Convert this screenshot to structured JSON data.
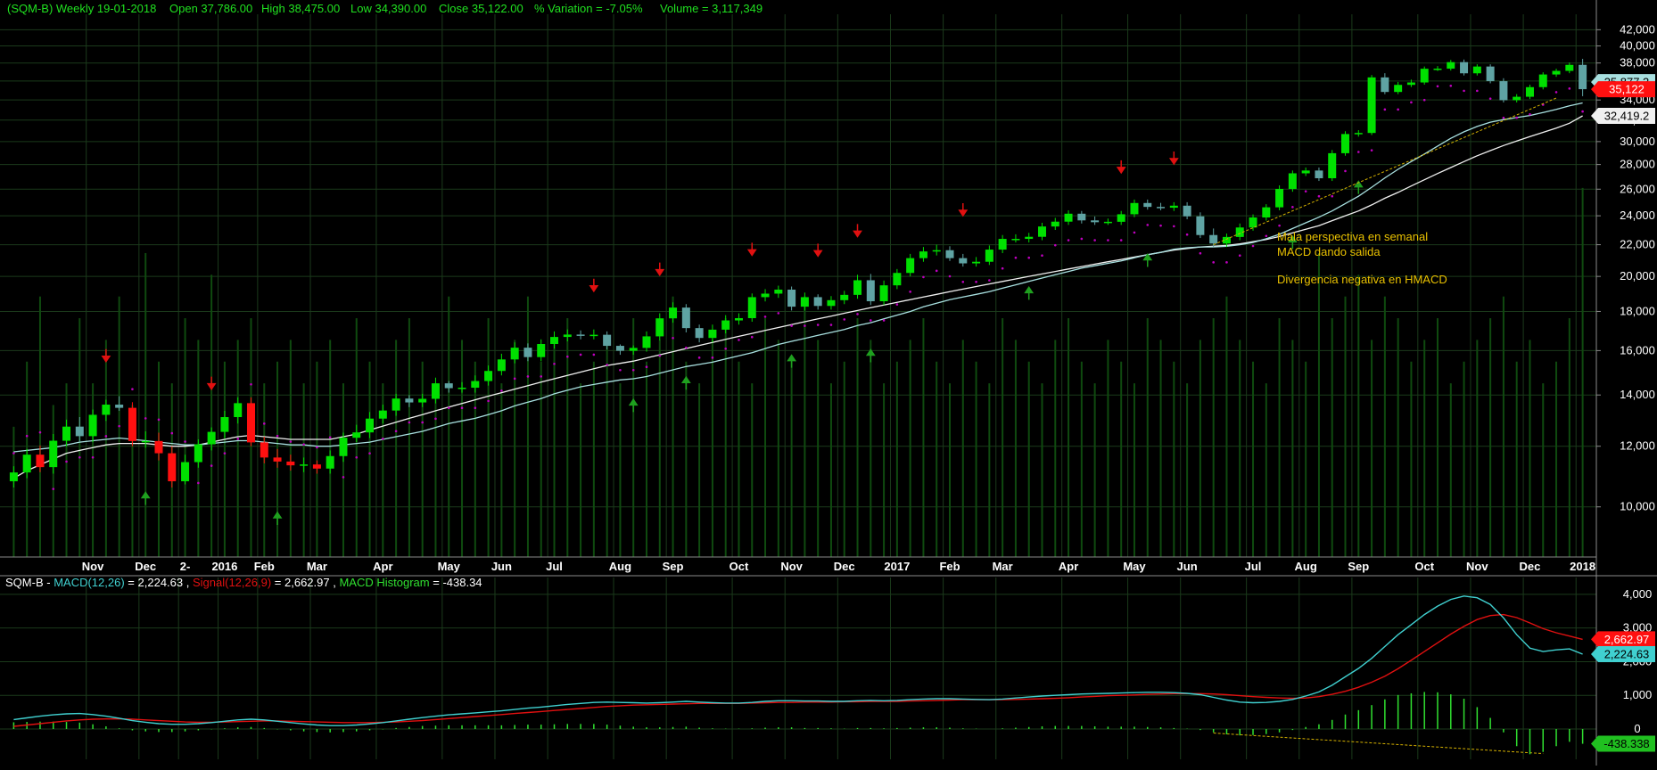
{
  "colors": {
    "background": "#000000",
    "grid": "#1b3a1b",
    "axis": "#8a8a8a",
    "up_candle": "#00e000",
    "down_candle": "#ff1010",
    "neutral_candle": "#5fa3a3",
    "ma_short": "#a8e0e0",
    "ma_long": "#f0f0f0",
    "sar_dots": "#c000c0",
    "volume": "#0f4a0f",
    "trendline": "#d4b000",
    "annotation": "#e8c000",
    "macd": "#40d0d0",
    "signal": "#e01010",
    "histogram": "#30e030",
    "header_text": "#20e020",
    "arrow_up": "#1fa01f",
    "arrow_down": "#e01010"
  },
  "header": {
    "title": "(SQM-B) Weekly  19-01-2018",
    "open": "Open 37,786.00",
    "high": "High 38,475.00",
    "low": "Low 34,390.00",
    "close": "Close 35,122.00",
    "variation": "% Variation = -7.05%",
    "volume": "Volume = 3,117,349"
  },
  "macd_header": {
    "symbol": "SQM-B",
    "macd_label": "MACD(12,26)",
    "macd_value": "2,224.63",
    "signal_label": "Signal(12,26,9)",
    "signal_value": "2,662.97",
    "hist_label": "MACD Histogram",
    "hist_value": "-438.34"
  },
  "price_axis": {
    "ticks": [
      "42,000",
      "40,000",
      "38,000",
      "36,000",
      "34,000",
      "32,000",
      "30,000",
      "28,000",
      "26,000",
      "24,000",
      "22,000",
      "20,000",
      "18,000",
      "16,000",
      "14,000",
      "12,000",
      "10,000"
    ],
    "tick_values": [
      42000,
      40000,
      38000,
      36000,
      34000,
      32000,
      30000,
      28000,
      26000,
      24000,
      22000,
      20000,
      18000,
      16000,
      14000,
      12000,
      10000
    ],
    "scale": "log",
    "ylim": [
      8600,
      44000
    ]
  },
  "price_tags": [
    {
      "label": "35,877.3",
      "value": 35877.3,
      "bg": "#a8e0e0"
    },
    {
      "label": "35,122",
      "value": 35122,
      "bg": "#ff1010"
    },
    {
      "label": "32,419.2",
      "value": 32419.2,
      "bg": "#f0f0f0"
    }
  ],
  "macd_axis": {
    "ticks": [
      "4,000",
      "3,000",
      "2,000",
      "1,000",
      "0"
    ],
    "tick_values": [
      4000,
      3000,
      2000,
      1000,
      0
    ],
    "ylim": [
      -900,
      4500
    ]
  },
  "macd_tags": [
    {
      "label": "2,662.97",
      "value": 2662.97,
      "bg": "#ff1010"
    },
    {
      "label": "2,224.63",
      "value": 2224.63,
      "bg": "#40d0d0"
    },
    {
      "label": "-438.338",
      "value": -438.338,
      "bg": "#20c020"
    }
  ],
  "x_labels": [
    "Nov",
    "Dec",
    "2-",
    "2016",
    "Feb",
    "Mar",
    "Apr",
    "May",
    "Jun",
    "Jul",
    "Aug",
    "Sep",
    "Oct",
    "Nov",
    "Dec",
    "2017",
    "Feb",
    "Mar",
    "Apr",
    "May",
    "Jun",
    "Jul",
    "Aug",
    "Sep",
    "Oct",
    "Nov",
    "Dec",
    "2018"
  ],
  "x_label_bars": [
    6,
    10,
    13,
    16,
    19,
    23,
    28,
    33,
    37,
    41,
    46,
    50,
    55,
    59,
    63,
    67,
    71,
    75,
    80,
    85,
    89,
    94,
    98,
    102,
    107,
    111,
    115,
    119
  ],
  "annotations": [
    "Mala perspectiva en semanal",
    "MACD dando salida",
    "Divergencia negativa en HMACD"
  ],
  "chart_data": {
    "type": "candlestick",
    "x": "weekly bars, Oct 2015 – 19-01-2018 (120 bars)",
    "candles": {
      "open": [
        10800,
        11090,
        11700,
        11270,
        12200,
        12730,
        12370,
        13190,
        13600,
        13470,
        12190,
        12190,
        11750,
        10800,
        11440,
        12070,
        12530,
        13100,
        13660,
        12140,
        11600,
        11460,
        11330,
        11360,
        11220,
        11650,
        12310,
        12510,
        13040,
        13360,
        13850,
        13690,
        13840,
        14500,
        14290,
        14310,
        14600,
        15050,
        15580,
        16140,
        15690,
        16320,
        16670,
        16790,
        16750,
        16780,
        16230,
        15990,
        16130,
        16700,
        17630,
        18210,
        17120,
        16620,
        17040,
        17520,
        17640,
        18790,
        18990,
        19220,
        18260,
        18790,
        18300,
        18620,
        18920,
        19770,
        18560,
        19470,
        20210,
        21130,
        21560,
        21640,
        21130,
        20800,
        20900,
        21680,
        22390,
        22390,
        22530,
        23240,
        23580,
        24150,
        23670,
        23540,
        23570,
        24110,
        24940,
        24650,
        24590,
        24740,
        23960,
        22650,
        22080,
        22520,
        23170,
        23880,
        24620,
        26020,
        27270,
        27500,
        26870,
        28970,
        30690,
        30790,
        36390,
        34830,
        35580,
        35840,
        37350,
        37360,
        38100,
        36840,
        37600,
        35980,
        33980,
        34330,
        35340,
        36710,
        37110,
        37790
      ],
      "close": [
        11090,
        11700,
        11270,
        12200,
        12730,
        12370,
        13190,
        13600,
        13470,
        12190,
        12190,
        11750,
        10800,
        11440,
        12070,
        12530,
        13100,
        13660,
        12140,
        11600,
        11460,
        11330,
        11360,
        11220,
        11650,
        12310,
        12510,
        13040,
        13360,
        13850,
        13690,
        13840,
        14500,
        14290,
        14310,
        14600,
        15050,
        15580,
        16140,
        15690,
        16320,
        16670,
        16790,
        16750,
        16780,
        16230,
        15990,
        16130,
        16700,
        17630,
        18210,
        17120,
        16620,
        17040,
        17520,
        17640,
        18790,
        18990,
        19220,
        18260,
        18790,
        18300,
        18620,
        18920,
        19770,
        18560,
        19470,
        20210,
        21130,
        21560,
        21640,
        21130,
        20800,
        20900,
        21680,
        22390,
        22390,
        22530,
        23240,
        23580,
        24150,
        23670,
        23540,
        23570,
        24110,
        24940,
        24650,
        24590,
        24740,
        23960,
        22650,
        22080,
        22520,
        23170,
        23880,
        24620,
        26020,
        27270,
        27500,
        26870,
        28970,
        30690,
        30790,
        36390,
        34830,
        35580,
        35840,
        37350,
        37360,
        38100,
        36840,
        37600,
        35980,
        33980,
        34330,
        35340,
        36710,
        37110,
        37790,
        35122
      ],
      "high": [
        11300,
        11900,
        12030,
        12450,
        13000,
        13100,
        13400,
        13800,
        13950,
        13700,
        12550,
        12500,
        12000,
        11700,
        12250,
        12700,
        13350,
        13900,
        13900,
        12350,
        11900,
        11700,
        11600,
        11500,
        11850,
        12500,
        12800,
        13300,
        13600,
        14050,
        14000,
        14050,
        14750,
        14600,
        14550,
        14850,
        15300,
        15850,
        16400,
        16350,
        16550,
        16950,
        17050,
        17000,
        17050,
        16950,
        16300,
        16250,
        16950,
        17900,
        18500,
        18400,
        17300,
        17300,
        17800,
        17900,
        19000,
        19250,
        19450,
        19400,
        19050,
        18950,
        18850,
        19150,
        20100,
        20150,
        19750,
        20450,
        21400,
        21850,
        22000,
        21900,
        21400,
        21200,
        21950,
        22650,
        22700,
        22800,
        23500,
        23850,
        24400,
        24350,
        23950,
        23800,
        24350,
        25200,
        25200,
        24950,
        25000,
        25000,
        24250,
        23100,
        22750,
        23450,
        24100,
        24850,
        26300,
        27500,
        27750,
        27750,
        29250,
        30950,
        31050,
        36650,
        36850,
        35900,
        36150,
        37600,
        37650,
        38350,
        38400,
        37850,
        37850,
        36300,
        34600,
        35600,
        36950,
        37350,
        38050,
        38475
      ],
      "low": [
        10600,
        10900,
        11100,
        11050,
        12000,
        12150,
        12150,
        12950,
        13350,
        12000,
        11950,
        11500,
        10600,
        10700,
        11250,
        11850,
        12300,
        12850,
        12000,
        11400,
        11250,
        11150,
        11100,
        11050,
        11050,
        11450,
        12150,
        12300,
        12850,
        13150,
        13500,
        13500,
        13650,
        14100,
        14100,
        14100,
        14400,
        14850,
        15400,
        15500,
        15500,
        16100,
        16450,
        16550,
        16550,
        16050,
        15800,
        15800,
        15950,
        16500,
        17400,
        16900,
        16400,
        16400,
        16850,
        17300,
        17450,
        18550,
        18750,
        18050,
        18050,
        18100,
        18100,
        18400,
        18700,
        18350,
        18350,
        19250,
        20000,
        20900,
        21300,
        20950,
        20600,
        20600,
        20700,
        21450,
        22150,
        22150,
        22300,
        23000,
        23350,
        23450,
        23350,
        23350,
        23350,
        23900,
        24450,
        24400,
        24350,
        23750,
        22450,
        21850,
        21850,
        22300,
        22950,
        23650,
        24400,
        25800,
        27050,
        26650,
        26650,
        28750,
        30450,
        30600,
        34600,
        34600,
        35350,
        35600,
        37100,
        37150,
        36600,
        36600,
        35750,
        33750,
        33750,
        34100,
        35100,
        36450,
        36850,
        34390
      ]
    },
    "ma_short": [
      11800,
      11850,
      11900,
      11950,
      12050,
      12150,
      12200,
      12250,
      12300,
      12250,
      12200,
      12150,
      12100,
      12050,
      12050,
      12100,
      12150,
      12200,
      12200,
      12150,
      12100,
      12050,
      12050,
      12000,
      12000,
      12050,
      12100,
      12150,
      12250,
      12350,
      12450,
      12550,
      12700,
      12850,
      12950,
      13050,
      13200,
      13350,
      13550,
      13700,
      13850,
      14050,
      14200,
      14350,
      14450,
      14550,
      14650,
      14700,
      14800,
      14950,
      15100,
      15250,
      15350,
      15450,
      15600,
      15750,
      15900,
      16100,
      16300,
      16450,
      16600,
      16750,
      16900,
      17050,
      17250,
      17400,
      17600,
      17800,
      18000,
      18250,
      18450,
      18650,
      18800,
      18950,
      19100,
      19300,
      19500,
      19700,
      19900,
      20100,
      20300,
      20500,
      20650,
      20800,
      20950,
      21150,
      21350,
      21500,
      21700,
      21800,
      21850,
      21850,
      21900,
      22000,
      22150,
      22400,
      22700,
      23100,
      23500,
      23900,
      24350,
      24900,
      25450,
      26150,
      26900,
      27600,
      28250,
      28900,
      29600,
      30300,
      30900,
      31400,
      31800,
      32050,
      32250,
      32450,
      32750,
      33050,
      33400,
      33700
    ],
    "ma_long": [
      10900,
      11150,
      11350,
      11550,
      11750,
      11850,
      11950,
      12050,
      12100,
      12100,
      12100,
      12050,
      12000,
      12000,
      12050,
      12150,
      12250,
      12350,
      12400,
      12350,
      12300,
      12250,
      12250,
      12250,
      12250,
      12350,
      12450,
      12600,
      12750,
      12900,
      13050,
      13200,
      13350,
      13500,
      13650,
      13800,
      13950,
      14100,
      14250,
      14400,
      14550,
      14700,
      14850,
      15000,
      15150,
      15300,
      15400,
      15500,
      15650,
      15800,
      15950,
      16100,
      16250,
      16400,
      16550,
      16700,
      16850,
      17000,
      17150,
      17300,
      17450,
      17600,
      17750,
      17900,
      18050,
      18200,
      18350,
      18500,
      18650,
      18800,
      18950,
      19100,
      19250,
      19400,
      19550,
      19700,
      19850,
      20000,
      20150,
      20300,
      20450,
      20600,
      20750,
      20900,
      21050,
      21200,
      21350,
      21500,
      21650,
      21750,
      21850,
      21900,
      21950,
      22050,
      22200,
      22350,
      22550,
      22800,
      23050,
      23300,
      23650,
      24000,
      24350,
      24800,
      25300,
      25750,
      26250,
      26750,
      27250,
      27750,
      28250,
      28750,
      29200,
      29650,
      30050,
      30450,
      30850,
      31250,
      31700,
      32419
    ],
    "macd": [
      280,
      330,
      380,
      420,
      450,
      460,
      430,
      380,
      320,
      250,
      200,
      160,
      140,
      140,
      160,
      190,
      230,
      270,
      290,
      270,
      230,
      190,
      150,
      120,
      100,
      100,
      120,
      150,
      190,
      240,
      290,
      340,
      380,
      420,
      450,
      480,
      510,
      540,
      580,
      620,
      650,
      690,
      730,
      760,
      790,
      800,
      790,
      780,
      770,
      780,
      800,
      820,
      800,
      780,
      770,
      770,
      790,
      820,
      840,
      840,
      830,
      830,
      820,
      820,
      840,
      850,
      840,
      850,
      870,
      890,
      900,
      900,
      890,
      880,
      870,
      890,
      920,
      950,
      980,
      1000,
      1020,
      1040,
      1050,
      1060,
      1070,
      1080,
      1090,
      1090,
      1080,
      1060,
      1020,
      940,
      860,
      800,
      780,
      790,
      820,
      880,
      980,
      1100,
      1300,
      1550,
      1800,
      2100,
      2450,
      2800,
      3100,
      3400,
      3650,
      3850,
      3950,
      3900,
      3700,
      3300,
      2800,
      2400,
      2300,
      2350,
      2380,
      2224.63
    ],
    "signal": [
      80,
      120,
      160,
      200,
      240,
      270,
      290,
      300,
      300,
      290,
      270,
      250,
      230,
      210,
      200,
      200,
      210,
      220,
      230,
      240,
      240,
      230,
      220,
      210,
      200,
      190,
      190,
      190,
      200,
      210,
      230,
      250,
      280,
      310,
      340,
      370,
      400,
      430,
      460,
      490,
      520,
      550,
      580,
      610,
      640,
      670,
      690,
      710,
      720,
      730,
      740,
      750,
      760,
      760,
      760,
      760,
      770,
      780,
      790,
      790,
      800,
      800,
      800,
      810,
      810,
      820,
      820,
      820,
      830,
      840,
      850,
      860,
      870,
      870,
      870,
      870,
      880,
      890,
      900,
      910,
      930,
      950,
      970,
      990,
      1000,
      1010,
      1030,
      1040,
      1050,
      1050,
      1050,
      1040,
      1020,
      990,
      960,
      940,
      920,
      910,
      920,
      960,
      1030,
      1120,
      1240,
      1390,
      1570,
      1790,
      2040,
      2300,
      2560,
      2820,
      3050,
      3250,
      3370,
      3400,
      3310,
      3150,
      2980,
      2860,
      2760,
      2662.97
    ],
    "histogram": [
      200,
      210,
      220,
      220,
      210,
      190,
      140,
      80,
      20,
      -40,
      -70,
      -90,
      -90,
      -70,
      -40,
      -10,
      20,
      50,
      60,
      30,
      -10,
      -40,
      -70,
      -90,
      -100,
      -90,
      -70,
      -40,
      -10,
      30,
      60,
      90,
      100,
      110,
      110,
      110,
      110,
      110,
      120,
      130,
      130,
      140,
      150,
      150,
      150,
      130,
      100,
      70,
      50,
      50,
      60,
      70,
      40,
      20,
      10,
      10,
      20,
      40,
      50,
      50,
      30,
      30,
      20,
      10,
      30,
      30,
      20,
      30,
      40,
      50,
      50,
      40,
      20,
      10,
      0,
      20,
      40,
      60,
      80,
      90,
      90,
      90,
      80,
      70,
      70,
      70,
      60,
      50,
      30,
      10,
      -30,
      -100,
      -160,
      -190,
      -180,
      -150,
      -100,
      -30,
      60,
      140,
      270,
      430,
      560,
      710,
      880,
      1010,
      1060,
      1100,
      1090,
      1030,
      900,
      650,
      330,
      -100,
      -510,
      -750,
      -680,
      -510,
      -380,
      -438.34
    ],
    "volume": [
      30,
      45,
      60,
      35,
      40,
      55,
      40,
      50,
      60,
      35,
      70,
      45,
      40,
      55,
      50,
      65,
      45,
      50,
      55,
      40,
      45,
      50,
      40,
      45,
      50,
      40,
      55,
      45,
      40,
      50,
      55,
      45,
      40,
      60,
      50,
      45,
      55,
      40,
      50,
      60,
      45,
      50,
      55,
      40,
      45,
      50,
      40,
      55,
      45,
      50,
      60,
      45,
      40,
      50,
      55,
      45,
      40,
      55,
      50,
      45,
      60,
      50,
      40,
      45,
      55,
      50,
      40,
      45,
      50,
      55,
      45,
      40,
      50,
      45,
      40,
      55,
      50,
      45,
      40,
      50,
      55,
      45,
      40,
      50,
      45,
      40,
      55,
      50,
      45,
      40,
      50,
      55,
      60,
      50,
      45,
      40,
      55,
      50,
      45,
      70,
      55,
      60,
      65,
      50,
      60,
      55,
      45,
      50,
      55,
      40,
      45,
      50,
      55,
      60,
      45,
      50,
      40,
      45,
      55,
      85
    ],
    "signals_up_bars": [
      10,
      20,
      47,
      51,
      59,
      65,
      77,
      86,
      97,
      102
    ],
    "signals_down_bars": [
      7,
      15,
      44,
      49,
      56,
      61,
      64,
      72,
      84,
      88
    ]
  }
}
